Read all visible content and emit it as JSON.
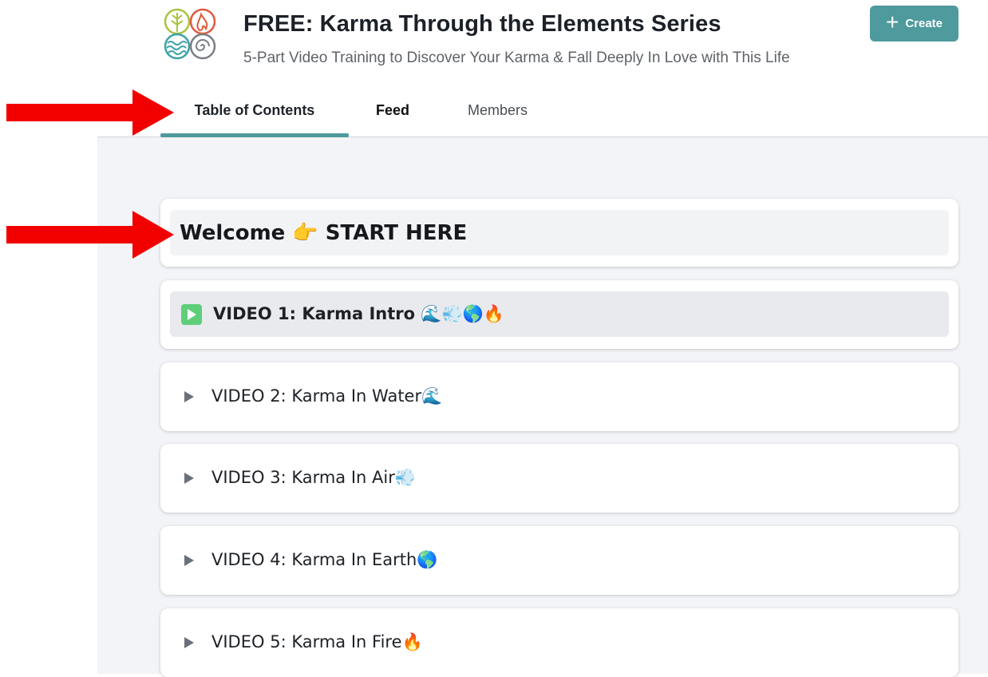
{
  "header": {
    "title": "FREE: Karma Through the Elements Series",
    "subtitle": "5-Part Video Training to Discover Your Karma & Fall Deeply In Love with This Life",
    "create_label": "Create",
    "create_icon": "plus-icon"
  },
  "tabs": [
    {
      "label": "Table of Contents",
      "active": true
    },
    {
      "label": "Feed",
      "active": false
    },
    {
      "label": "Members",
      "active": false
    }
  ],
  "sections": {
    "welcome": {
      "title": "Welcome 👉 START HERE"
    },
    "videos": [
      {
        "title": "VIDEO 1: Karma Intro 🌊💨🌎🔥",
        "active": true,
        "icon": "play-square-icon"
      },
      {
        "title": "VIDEO 2: Karma In Water🌊",
        "active": false,
        "icon": "triangle-right-icon"
      },
      {
        "title": "VIDEO 3: Karma In Air💨",
        "active": false,
        "icon": "triangle-right-icon"
      },
      {
        "title": "VIDEO 4: Karma In Earth🌎",
        "active": false,
        "icon": "triangle-right-icon"
      },
      {
        "title": "VIDEO 5: Karma In Fire🔥",
        "active": false,
        "icon": "triangle-right-icon"
      }
    ]
  },
  "colors": {
    "accent": "#4e9a9d",
    "play_green": "#5ecf78",
    "annotation_red": "#f20000"
  }
}
